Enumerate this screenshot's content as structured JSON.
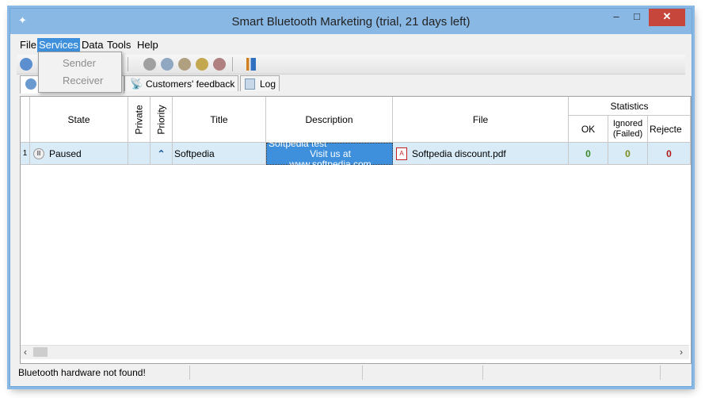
{
  "window": {
    "title": "Smart Bluetooth Marketing (trial, 21 days left)"
  },
  "menu": [
    "File",
    "Services",
    "Data",
    "Tools",
    "Help"
  ],
  "services_menu": [
    "Sender",
    "Receiver"
  ],
  "tabs": [
    "Customers' feedback",
    "Log"
  ],
  "columns": {
    "state": "State",
    "private": "Private",
    "priority": "Priority",
    "title": "Title",
    "description": "Description",
    "file": "File",
    "statistics": "Statistics",
    "ok": "OK",
    "ignored": "Ignored (Failed)",
    "rejected": "Rejecte"
  },
  "rows": [
    {
      "index": "1",
      "state": "Paused",
      "title": "Softpedia",
      "description_line1": "Softpedia test",
      "description_line2": "Visit us at www.softpedia.com",
      "file": "Softpedia discount.pdf",
      "ok": "0",
      "ignored": "0",
      "rejected": "0"
    }
  ],
  "status": {
    "message": "Bluetooth hardware not found!"
  },
  "colors": {
    "titlebar": "#8ab8e4",
    "selection": "#3e90dc",
    "row_highlight": "#d8ebf7",
    "ok_green": "#3a8a2a",
    "ignored_olive": "#7a8a1a",
    "rejected_red": "#b01818"
  }
}
